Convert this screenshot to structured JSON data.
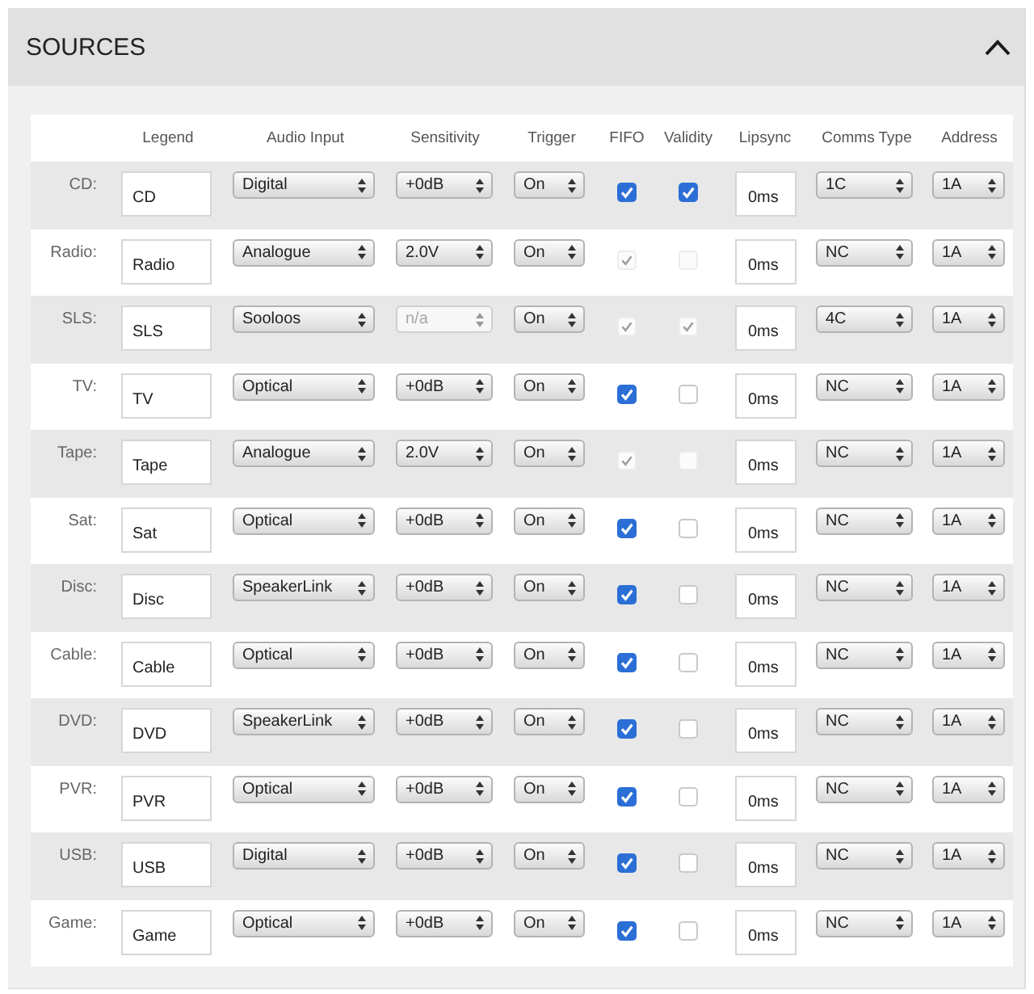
{
  "panel": {
    "title": "SOURCES",
    "expanded": true
  },
  "table": {
    "columns": [
      "Legend",
      "Audio Input",
      "Sensitivity",
      "Trigger",
      "FIFO",
      "Validity",
      "Lipsync",
      "Comms Type",
      "Address"
    ],
    "rows": [
      {
        "label": "CD:",
        "legend": "CD",
        "audio_input": "Digital",
        "sensitivity": {
          "value": "+0dB",
          "disabled": false
        },
        "trigger": "On",
        "fifo": {
          "checked": true,
          "disabled": false
        },
        "validity": {
          "checked": true,
          "disabled": false
        },
        "lipsync": "0ms",
        "comms_type": "1C",
        "address": "1A"
      },
      {
        "label": "Radio:",
        "legend": "Radio",
        "audio_input": "Analogue",
        "sensitivity": {
          "value": "2.0V",
          "disabled": false
        },
        "trigger": "On",
        "fifo": {
          "checked": true,
          "disabled": true
        },
        "validity": {
          "checked": false,
          "disabled": true
        },
        "lipsync": "0ms",
        "comms_type": "NC",
        "address": "1A"
      },
      {
        "label": "SLS:",
        "legend": "SLS",
        "audio_input": "Sooloos",
        "sensitivity": {
          "value": "n/a",
          "disabled": true
        },
        "trigger": "On",
        "fifo": {
          "checked": true,
          "disabled": true
        },
        "validity": {
          "checked": true,
          "disabled": true
        },
        "lipsync": "0ms",
        "comms_type": "4C",
        "address": "1A"
      },
      {
        "label": "TV:",
        "legend": "TV",
        "audio_input": "Optical",
        "sensitivity": {
          "value": "+0dB",
          "disabled": false
        },
        "trigger": "On",
        "fifo": {
          "checked": true,
          "disabled": false
        },
        "validity": {
          "checked": false,
          "disabled": false
        },
        "lipsync": "0ms",
        "comms_type": "NC",
        "address": "1A"
      },
      {
        "label": "Tape:",
        "legend": "Tape",
        "audio_input": "Analogue",
        "sensitivity": {
          "value": "2.0V",
          "disabled": false
        },
        "trigger": "On",
        "fifo": {
          "checked": true,
          "disabled": true
        },
        "validity": {
          "checked": false,
          "disabled": true
        },
        "lipsync": "0ms",
        "comms_type": "NC",
        "address": "1A"
      },
      {
        "label": "Sat:",
        "legend": "Sat",
        "audio_input": "Optical",
        "sensitivity": {
          "value": "+0dB",
          "disabled": false
        },
        "trigger": "On",
        "fifo": {
          "checked": true,
          "disabled": false
        },
        "validity": {
          "checked": false,
          "disabled": false
        },
        "lipsync": "0ms",
        "comms_type": "NC",
        "address": "1A"
      },
      {
        "label": "Disc:",
        "legend": "Disc",
        "audio_input": "SpeakerLink",
        "sensitivity": {
          "value": "+0dB",
          "disabled": false
        },
        "trigger": "On",
        "fifo": {
          "checked": true,
          "disabled": false
        },
        "validity": {
          "checked": false,
          "disabled": false
        },
        "lipsync": "0ms",
        "comms_type": "NC",
        "address": "1A"
      },
      {
        "label": "Cable:",
        "legend": "Cable",
        "audio_input": "Optical",
        "sensitivity": {
          "value": "+0dB",
          "disabled": false
        },
        "trigger": "On",
        "fifo": {
          "checked": true,
          "disabled": false
        },
        "validity": {
          "checked": false,
          "disabled": false
        },
        "lipsync": "0ms",
        "comms_type": "NC",
        "address": "1A"
      },
      {
        "label": "DVD:",
        "legend": "DVD",
        "audio_input": "SpeakerLink",
        "sensitivity": {
          "value": "+0dB",
          "disabled": false
        },
        "trigger": "On",
        "fifo": {
          "checked": true,
          "disabled": false
        },
        "validity": {
          "checked": false,
          "disabled": false
        },
        "lipsync": "0ms",
        "comms_type": "NC",
        "address": "1A"
      },
      {
        "label": "PVR:",
        "legend": "PVR",
        "audio_input": "Optical",
        "sensitivity": {
          "value": "+0dB",
          "disabled": false
        },
        "trigger": "On",
        "fifo": {
          "checked": true,
          "disabled": false
        },
        "validity": {
          "checked": false,
          "disabled": false
        },
        "lipsync": "0ms",
        "comms_type": "NC",
        "address": "1A"
      },
      {
        "label": "USB:",
        "legend": "USB",
        "audio_input": "Digital",
        "sensitivity": {
          "value": "+0dB",
          "disabled": false
        },
        "trigger": "On",
        "fifo": {
          "checked": true,
          "disabled": false
        },
        "validity": {
          "checked": false,
          "disabled": false
        },
        "lipsync": "0ms",
        "comms_type": "NC",
        "address": "1A"
      },
      {
        "label": "Game:",
        "legend": "Game",
        "audio_input": "Optical",
        "sensitivity": {
          "value": "+0dB",
          "disabled": false
        },
        "trigger": "On",
        "fifo": {
          "checked": true,
          "disabled": false
        },
        "validity": {
          "checked": false,
          "disabled": false
        },
        "lipsync": "0ms",
        "comms_type": "NC",
        "address": "1A"
      }
    ]
  }
}
